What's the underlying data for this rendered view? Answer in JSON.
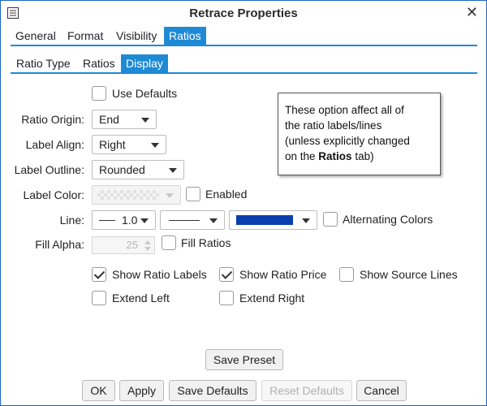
{
  "window": {
    "title": "Retrace Properties",
    "close_glyph": "✕"
  },
  "main_tabs": [
    {
      "label": "General",
      "active": false
    },
    {
      "label": "Format",
      "active": false
    },
    {
      "label": "Visibility",
      "active": false
    },
    {
      "label": "Ratios",
      "active": true
    }
  ],
  "sub_tabs": [
    {
      "label": "Ratio Type",
      "active": false
    },
    {
      "label": "Ratios",
      "active": false
    },
    {
      "label": "Display",
      "active": true
    }
  ],
  "form": {
    "use_defaults": {
      "label": "Use Defaults",
      "checked": false
    },
    "ratio_origin": {
      "label": "Ratio Origin:",
      "value": "End"
    },
    "label_align": {
      "label": "Label Align:",
      "value": "Right"
    },
    "label_outline": {
      "label": "Label Outline:",
      "value": "Rounded"
    },
    "label_color": {
      "label": "Label Color:",
      "enabled_label": "Enabled",
      "enabled_checked": false
    },
    "line": {
      "label": "Line:",
      "width_value": "1.0",
      "color": "#0a3fb0",
      "alternating_label": "Alternating Colors",
      "alternating_checked": false
    },
    "fill_alpha": {
      "label": "Fill Alpha:",
      "value": "25",
      "fill_ratios_label": "Fill Ratios",
      "fill_ratios_checked": false
    }
  },
  "options": {
    "show_ratio_labels": {
      "label": "Show Ratio Labels",
      "checked": true
    },
    "show_ratio_price": {
      "label": "Show Ratio Price",
      "checked": true
    },
    "show_source_lines": {
      "label": "Show Source Lines",
      "checked": false
    },
    "extend_left": {
      "label": "Extend Left",
      "checked": false
    },
    "extend_right": {
      "label": "Extend Right",
      "checked": false
    }
  },
  "note": {
    "line1": "These option affect all of",
    "line2": "the ratio labels/lines",
    "line3": "(unless explicitly changed",
    "line4_pre": "on the ",
    "line4_bold": "Ratios",
    "line4_post": " tab)"
  },
  "buttons": {
    "save_preset": "Save Preset",
    "ok": "OK",
    "apply": "Apply",
    "save_defaults": "Save Defaults",
    "reset_defaults": "Reset Defaults",
    "cancel": "Cancel"
  },
  "colors": {
    "accent": "#1e8ad6",
    "border": "#1f63c6",
    "line_color": "#0a3fb0"
  }
}
